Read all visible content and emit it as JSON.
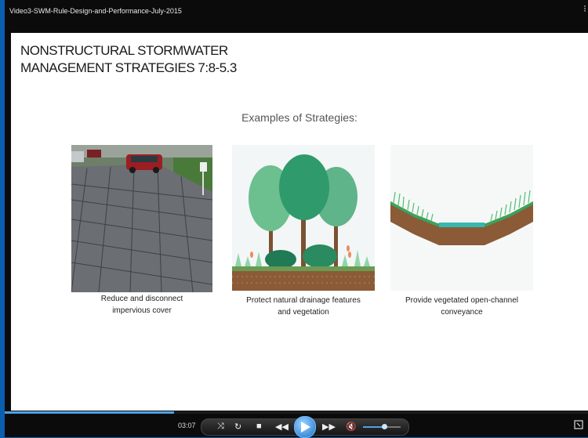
{
  "window": {
    "title": "Video3-SWM-Rule-Design-and-Performance-July-2015"
  },
  "slide": {
    "heading_line1": "NONSTRUCTURAL STORMWATER",
    "heading_line2": "MANAGEMENT STRATEGIES 7:8-5.3",
    "subheading": "Examples of Strategies:",
    "cards": [
      {
        "caption_line1": "Reduce and disconnect",
        "caption_line2": "impervious cover"
      },
      {
        "caption_line1": "Protect natural drainage features",
        "caption_line2": "and vegetation"
      },
      {
        "caption_line1": "Provide vegetated open-channel",
        "caption_line2": "conveyance"
      }
    ]
  },
  "player": {
    "time": "03:07",
    "progress_fraction": 0.29,
    "volume_fraction": 0.58,
    "accent_color": "#4ea2e8"
  }
}
